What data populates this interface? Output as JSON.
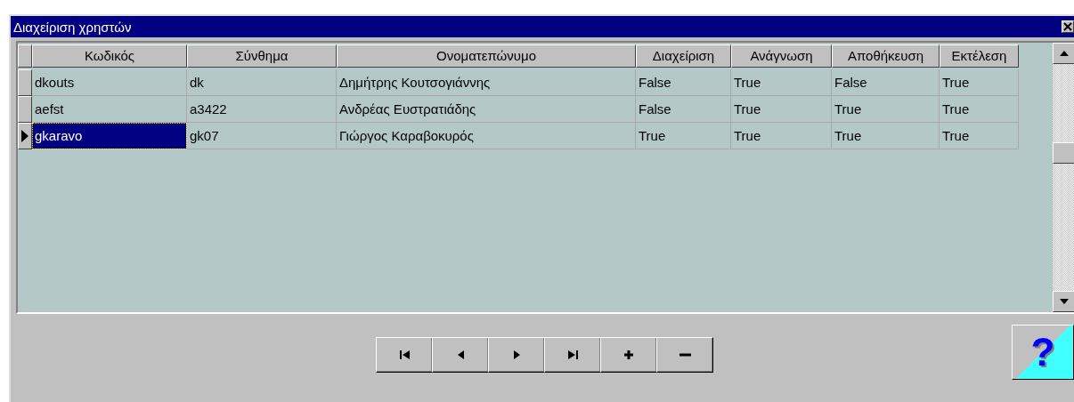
{
  "window": {
    "title": "Διαχείριση χρηστών"
  },
  "table": {
    "columns": [
      "Κωδικός",
      "Σύνθημα",
      "Ονοματεπώνυμο",
      "Διαχείριση",
      "Ανάγνωση",
      "Αποθήκευση",
      "Εκτέλεση"
    ],
    "rows": [
      {
        "selected": false,
        "cells": [
          "dkouts",
          "dk",
          "Δημήτρης Κουτσογιάννης",
          "False",
          "True",
          "False",
          "True"
        ]
      },
      {
        "selected": false,
        "cells": [
          "aefst",
          "a3422",
          "Ανδρέας Ευστρατιάδης",
          "False",
          "True",
          "True",
          "True"
        ]
      },
      {
        "selected": true,
        "cells": [
          "gkaravo",
          "gk07",
          "Γιώργος Καραβοκυρός",
          "True",
          "True",
          "True",
          "True"
        ]
      }
    ]
  },
  "navigator": {
    "buttons": [
      {
        "kind": "first"
      },
      {
        "kind": "prior"
      },
      {
        "kind": "next"
      },
      {
        "kind": "last"
      },
      {
        "kind": "insert"
      },
      {
        "kind": "delete"
      }
    ]
  },
  "help_button": {
    "label": "?"
  }
}
